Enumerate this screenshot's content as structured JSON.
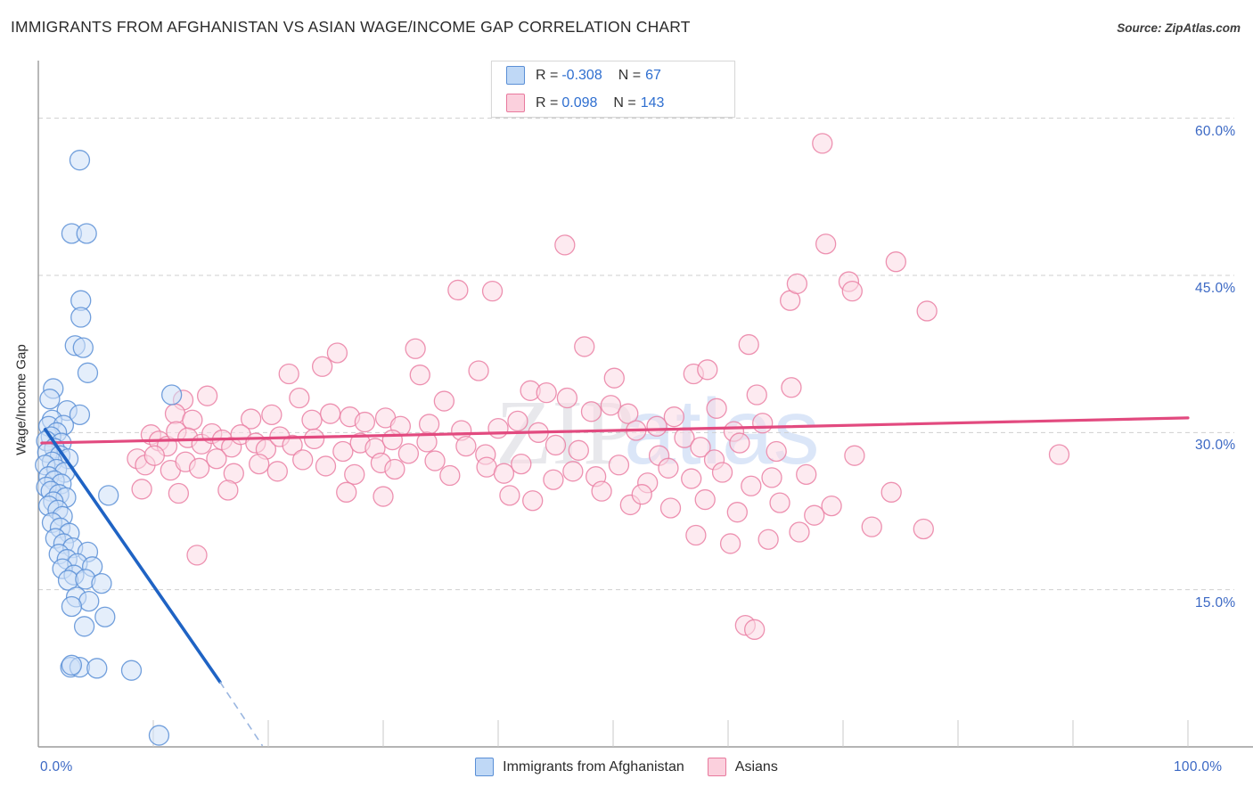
{
  "header": {
    "title": "IMMIGRANTS FROM AFGHANISTAN VS ASIAN WAGE/INCOME GAP CORRELATION CHART",
    "source": "Source: ZipAtlas.com"
  },
  "watermark": {
    "part1": "ZIP",
    "part2": "atlas"
  },
  "stats": {
    "blue": {
      "r_label": "R =",
      "r_value": "-0.308",
      "n_label": "N =",
      "n_value": "67"
    },
    "pink": {
      "r_label": "R =",
      "r_value": "0.098",
      "n_label": "N =",
      "n_value": "143"
    }
  },
  "legend": {
    "blue_label": "Immigrants from Afghanistan",
    "pink_label": "Asians"
  },
  "axes": {
    "y_title": "Wage/Income Gap",
    "y_ticks": [
      "60.0%",
      "45.0%",
      "30.0%",
      "15.0%"
    ],
    "x_ticks": [
      "0.0%",
      "100.0%"
    ]
  },
  "chart_data": {
    "type": "scatter",
    "title": "IMMIGRANTS FROM AFGHANISTAN VS ASIAN WAGE/INCOME GAP CORRELATION CHART",
    "xlabel": "",
    "ylabel": "Wage/Income Gap",
    "xlim": [
      0,
      100
    ],
    "ylim": [
      0,
      65.5
    ],
    "x_tick_values": [
      0,
      100
    ],
    "y_tick_values": [
      15,
      30,
      45,
      60
    ],
    "grid": "horizontal-dashed",
    "legend_position": "bottom-center",
    "colors": {
      "blue_fill": "#cde0f7",
      "blue_edge": "#5a8fd6",
      "pink_fill": "#fbd8e3",
      "pink_edge": "#ea7fa3",
      "blue_line": "#1f63c4",
      "pink_line": "#e24a7f",
      "tick_text": "#3b68c4"
    },
    "series": [
      {
        "name": "Immigrants from Afghanistan",
        "color": "#cde0f7",
        "r": -0.308,
        "n": 67,
        "trend": {
          "x0": 0.6,
          "y0": 30.3,
          "x1": 15.8,
          "y1": 6.2,
          "dash_x1": 19.5,
          "dash_y1": 0.1
        },
        "points": [
          [
            3.6,
            56.0
          ],
          [
            2.9,
            49.0
          ],
          [
            4.2,
            49.0
          ],
          [
            3.7,
            42.6
          ],
          [
            3.7,
            41.0
          ],
          [
            3.2,
            38.3
          ],
          [
            3.9,
            38.1
          ],
          [
            4.3,
            35.7
          ],
          [
            1.3,
            34.2
          ],
          [
            1.0,
            33.2
          ],
          [
            11.6,
            33.6
          ],
          [
            2.5,
            32.1
          ],
          [
            3.6,
            31.7
          ],
          [
            1.2,
            31.2
          ],
          [
            0.9,
            30.6
          ],
          [
            2.2,
            30.7
          ],
          [
            1.6,
            30.0
          ],
          [
            1.1,
            29.6
          ],
          [
            0.7,
            29.2
          ],
          [
            2.0,
            29.0
          ],
          [
            1.4,
            28.5
          ],
          [
            0.8,
            28.1
          ],
          [
            1.9,
            27.8
          ],
          [
            2.6,
            27.5
          ],
          [
            1.2,
            27.2
          ],
          [
            0.6,
            26.9
          ],
          [
            1.6,
            26.5
          ],
          [
            2.3,
            26.2
          ],
          [
            0.9,
            25.8
          ],
          [
            1.4,
            25.4
          ],
          [
            2.0,
            25.1
          ],
          [
            0.7,
            24.8
          ],
          [
            1.1,
            24.4
          ],
          [
            1.8,
            24.1
          ],
          [
            2.4,
            23.8
          ],
          [
            1.3,
            23.4
          ],
          [
            0.9,
            23.0
          ],
          [
            1.7,
            22.6
          ],
          [
            6.1,
            24.0
          ],
          [
            2.1,
            22.0
          ],
          [
            1.2,
            21.4
          ],
          [
            1.9,
            20.9
          ],
          [
            2.7,
            20.4
          ],
          [
            1.5,
            19.9
          ],
          [
            2.2,
            19.4
          ],
          [
            3.0,
            19.0
          ],
          [
            1.8,
            18.4
          ],
          [
            4.3,
            18.6
          ],
          [
            2.5,
            17.9
          ],
          [
            3.4,
            17.5
          ],
          [
            2.1,
            17.0
          ],
          [
            4.7,
            17.2
          ],
          [
            3.1,
            16.4
          ],
          [
            2.6,
            15.9
          ],
          [
            4.1,
            16.0
          ],
          [
            5.5,
            15.6
          ],
          [
            3.3,
            14.3
          ],
          [
            4.4,
            13.9
          ],
          [
            2.9,
            13.4
          ],
          [
            5.8,
            12.4
          ],
          [
            4.0,
            11.5
          ],
          [
            2.8,
            7.6
          ],
          [
            3.6,
            7.6
          ],
          [
            5.1,
            7.5
          ],
          [
            8.1,
            7.3
          ],
          [
            2.9,
            7.8
          ],
          [
            10.5,
            1.1
          ]
        ]
      },
      {
        "name": "Asians",
        "color": "#fbd8e3",
        "r": 0.098,
        "n": 143,
        "trend": {
          "x0": 0.3,
          "y0": 29.0,
          "x1": 100.0,
          "y1": 31.4
        },
        "points": [
          [
            68.2,
            57.6
          ],
          [
            45.8,
            47.9
          ],
          [
            68.5,
            48.0
          ],
          [
            74.6,
            46.3
          ],
          [
            36.5,
            43.6
          ],
          [
            39.5,
            43.5
          ],
          [
            65.4,
            42.6
          ],
          [
            66.0,
            44.2
          ],
          [
            70.5,
            44.4
          ],
          [
            70.8,
            43.5
          ],
          [
            77.3,
            41.6
          ],
          [
            26.0,
            37.6
          ],
          [
            32.8,
            38.0
          ],
          [
            61.8,
            38.4
          ],
          [
            47.5,
            38.2
          ],
          [
            21.8,
            35.6
          ],
          [
            24.7,
            36.3
          ],
          [
            33.2,
            35.5
          ],
          [
            38.3,
            35.9
          ],
          [
            50.1,
            35.2
          ],
          [
            57.0,
            35.6
          ],
          [
            58.2,
            36.0
          ],
          [
            65.5,
            34.3
          ],
          [
            12.6,
            33.1
          ],
          [
            14.7,
            33.5
          ],
          [
            22.7,
            33.3
          ],
          [
            35.3,
            33.0
          ],
          [
            42.8,
            34.0
          ],
          [
            44.2,
            33.8
          ],
          [
            46.0,
            33.3
          ],
          [
            48.1,
            32.0
          ],
          [
            49.8,
            32.6
          ],
          [
            51.3,
            31.8
          ],
          [
            55.3,
            31.5
          ],
          [
            59.0,
            32.3
          ],
          [
            62.5,
            33.6
          ],
          [
            11.9,
            31.8
          ],
          [
            13.4,
            31.2
          ],
          [
            18.5,
            31.3
          ],
          [
            20.3,
            31.7
          ],
          [
            23.8,
            31.2
          ],
          [
            25.4,
            31.8
          ],
          [
            27.1,
            31.5
          ],
          [
            28.4,
            31.0
          ],
          [
            30.2,
            31.4
          ],
          [
            31.5,
            30.6
          ],
          [
            34.0,
            30.8
          ],
          [
            36.8,
            30.2
          ],
          [
            40.0,
            30.4
          ],
          [
            41.7,
            31.1
          ],
          [
            43.5,
            30.0
          ],
          [
            52.0,
            30.2
          ],
          [
            53.8,
            30.6
          ],
          [
            56.2,
            29.5
          ],
          [
            60.5,
            30.1
          ],
          [
            63.0,
            30.9
          ],
          [
            9.8,
            29.8
          ],
          [
            10.5,
            29.2
          ],
          [
            11.2,
            28.7
          ],
          [
            12.0,
            30.1
          ],
          [
            13.0,
            29.5
          ],
          [
            14.2,
            28.9
          ],
          [
            15.1,
            29.9
          ],
          [
            16.0,
            29.3
          ],
          [
            16.8,
            28.6
          ],
          [
            17.6,
            29.8
          ],
          [
            18.9,
            29.0
          ],
          [
            19.8,
            28.4
          ],
          [
            21.0,
            29.6
          ],
          [
            22.1,
            28.8
          ],
          [
            24.0,
            29.4
          ],
          [
            26.5,
            28.2
          ],
          [
            28.0,
            29.0
          ],
          [
            29.3,
            28.5
          ],
          [
            30.8,
            29.3
          ],
          [
            32.2,
            28.0
          ],
          [
            33.8,
            29.1
          ],
          [
            37.2,
            28.7
          ],
          [
            38.9,
            27.9
          ],
          [
            45.0,
            28.8
          ],
          [
            47.0,
            28.3
          ],
          [
            54.0,
            27.8
          ],
          [
            57.6,
            28.6
          ],
          [
            58.8,
            27.4
          ],
          [
            61.0,
            29.0
          ],
          [
            64.2,
            28.2
          ],
          [
            8.6,
            27.5
          ],
          [
            9.3,
            26.9
          ],
          [
            10.1,
            27.8
          ],
          [
            11.5,
            26.4
          ],
          [
            12.8,
            27.2
          ],
          [
            14.0,
            26.6
          ],
          [
            15.5,
            27.5
          ],
          [
            17.0,
            26.1
          ],
          [
            19.2,
            27.0
          ],
          [
            20.8,
            26.3
          ],
          [
            23.0,
            27.4
          ],
          [
            25.0,
            26.8
          ],
          [
            27.5,
            26.0
          ],
          [
            29.8,
            27.1
          ],
          [
            31.0,
            26.5
          ],
          [
            34.5,
            27.3
          ],
          [
            35.8,
            25.9
          ],
          [
            39.0,
            26.7
          ],
          [
            40.5,
            26.1
          ],
          [
            42.0,
            27.0
          ],
          [
            44.8,
            25.5
          ],
          [
            46.5,
            26.3
          ],
          [
            48.5,
            25.8
          ],
          [
            50.5,
            26.9
          ],
          [
            53.0,
            25.2
          ],
          [
            54.8,
            26.6
          ],
          [
            56.8,
            25.6
          ],
          [
            59.5,
            26.2
          ],
          [
            62.0,
            24.9
          ],
          [
            63.8,
            25.7
          ],
          [
            66.8,
            26.0
          ],
          [
            9.0,
            24.6
          ],
          [
            12.2,
            24.2
          ],
          [
            16.5,
            24.5
          ],
          [
            26.8,
            24.3
          ],
          [
            30.0,
            23.9
          ],
          [
            41.0,
            24.0
          ],
          [
            43.0,
            23.5
          ],
          [
            49.0,
            24.4
          ],
          [
            51.5,
            23.1
          ],
          [
            52.5,
            24.1
          ],
          [
            55.0,
            22.8
          ],
          [
            58.0,
            23.6
          ],
          [
            60.8,
            22.4
          ],
          [
            64.5,
            23.3
          ],
          [
            67.5,
            22.1
          ],
          [
            69.0,
            23.0
          ],
          [
            72.5,
            21.0
          ],
          [
            66.2,
            20.5
          ],
          [
            63.5,
            19.8
          ],
          [
            60.2,
            19.4
          ],
          [
            57.2,
            20.2
          ],
          [
            71.0,
            27.8
          ],
          [
            74.2,
            24.3
          ],
          [
            77.0,
            20.8
          ],
          [
            88.8,
            27.9
          ],
          [
            13.8,
            18.3
          ],
          [
            61.5,
            11.6
          ],
          [
            62.3,
            11.2
          ]
        ]
      }
    ]
  }
}
